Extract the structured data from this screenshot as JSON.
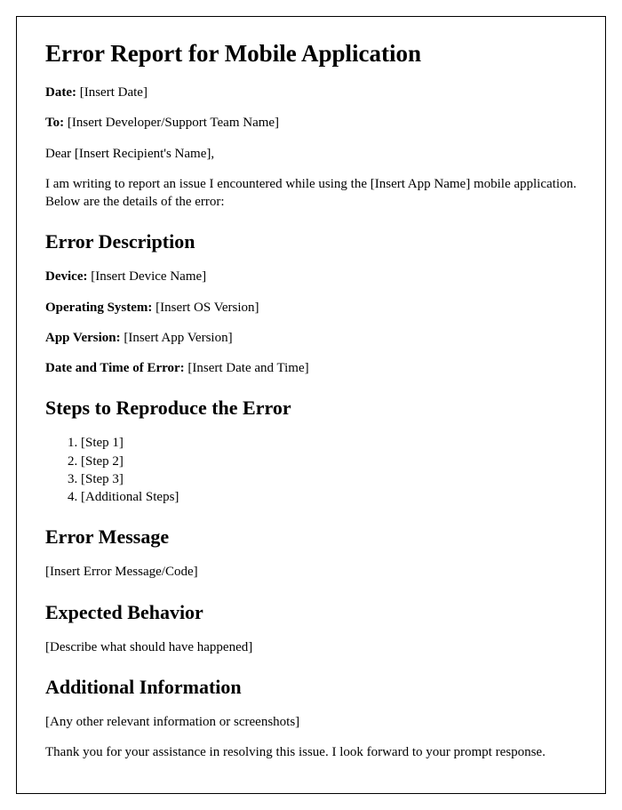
{
  "title": "Error Report for Mobile Application",
  "meta": {
    "date_label": "Date:",
    "date_value": " [Insert Date]",
    "to_label": "To:",
    "to_value": " [Insert Developer/Support Team Name]",
    "salutation": "Dear [Insert Recipient's Name],",
    "intro": "I am writing to report an issue I encountered while using the [Insert App Name] mobile application. Below are the details of the error:"
  },
  "sections": {
    "error_description": {
      "heading": "Error Description",
      "fields": {
        "device_label": "Device:",
        "device_value": " [Insert Device Name]",
        "os_label": "Operating System:",
        "os_value": " [Insert OS Version]",
        "appver_label": "App Version:",
        "appver_value": " [Insert App Version]",
        "datetime_label": "Date and Time of Error:",
        "datetime_value": " [Insert Date and Time]"
      }
    },
    "steps": {
      "heading": "Steps to Reproduce the Error",
      "items": [
        "[Step 1]",
        "[Step 2]",
        "[Step 3]",
        "[Additional Steps]"
      ]
    },
    "error_message": {
      "heading": "Error Message",
      "body": "[Insert Error Message/Code]"
    },
    "expected": {
      "heading": "Expected Behavior",
      "body": "[Describe what should have happened]"
    },
    "additional": {
      "heading": "Additional Information",
      "body": "[Any other relevant information or screenshots]"
    },
    "closing": {
      "thanks": "Thank you for your assistance in resolving this issue. I look forward to your prompt response."
    }
  }
}
